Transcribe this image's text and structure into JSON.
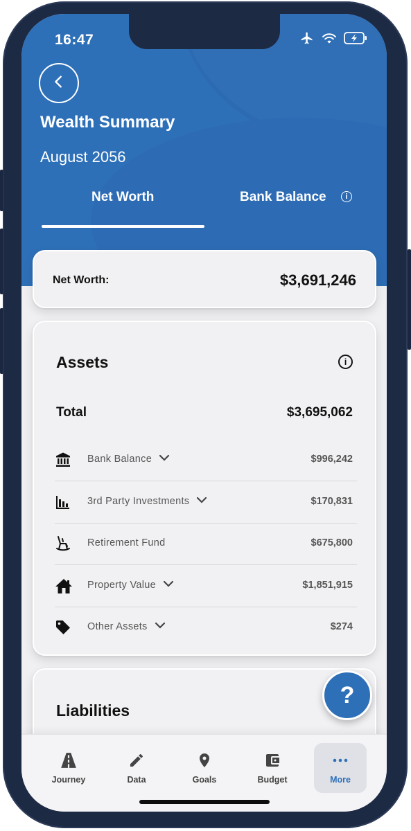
{
  "status_bar": {
    "time": "16:47"
  },
  "header": {
    "title": "Wealth Summary",
    "subtitle": "August 2056",
    "tabs": [
      {
        "label": "Net Worth",
        "active": true
      },
      {
        "label": "Bank Balance",
        "active": false
      }
    ]
  },
  "net_worth": {
    "label": "Net Worth:",
    "value": "$3,691,246"
  },
  "assets": {
    "title": "Assets",
    "total_label": "Total",
    "total_value": "$3,695,062",
    "rows": [
      {
        "icon": "bank-icon",
        "label": "Bank Balance",
        "value": "$996,242",
        "expandable": true
      },
      {
        "icon": "bar-chart-icon",
        "label": "3rd Party Investments",
        "value": "$170,831",
        "expandable": true
      },
      {
        "icon": "rocking-chair-icon",
        "label": "Retirement Fund",
        "value": "$675,800",
        "expandable": false
      },
      {
        "icon": "house-icon",
        "label": "Property Value",
        "value": "$1,851,915",
        "expandable": true
      },
      {
        "icon": "tag-icon",
        "label": "Other Assets",
        "value": "$274",
        "expandable": true
      }
    ]
  },
  "liabilities": {
    "title": "Liabilities"
  },
  "help": {
    "label": "?"
  },
  "bottom_nav": [
    {
      "label": "Journey",
      "icon": "road-icon",
      "active": false
    },
    {
      "label": "Data",
      "icon": "pencil-icon",
      "active": false
    },
    {
      "label": "Goals",
      "icon": "location-pin-icon",
      "active": false
    },
    {
      "label": "Budget",
      "icon": "wallet-icon",
      "active": false
    },
    {
      "label": "More",
      "icon": "more-dots-icon",
      "active": true
    }
  ],
  "colors": {
    "brand": "#2e70b8",
    "background": "#f0f0f2",
    "frame": "#1d2a44"
  }
}
